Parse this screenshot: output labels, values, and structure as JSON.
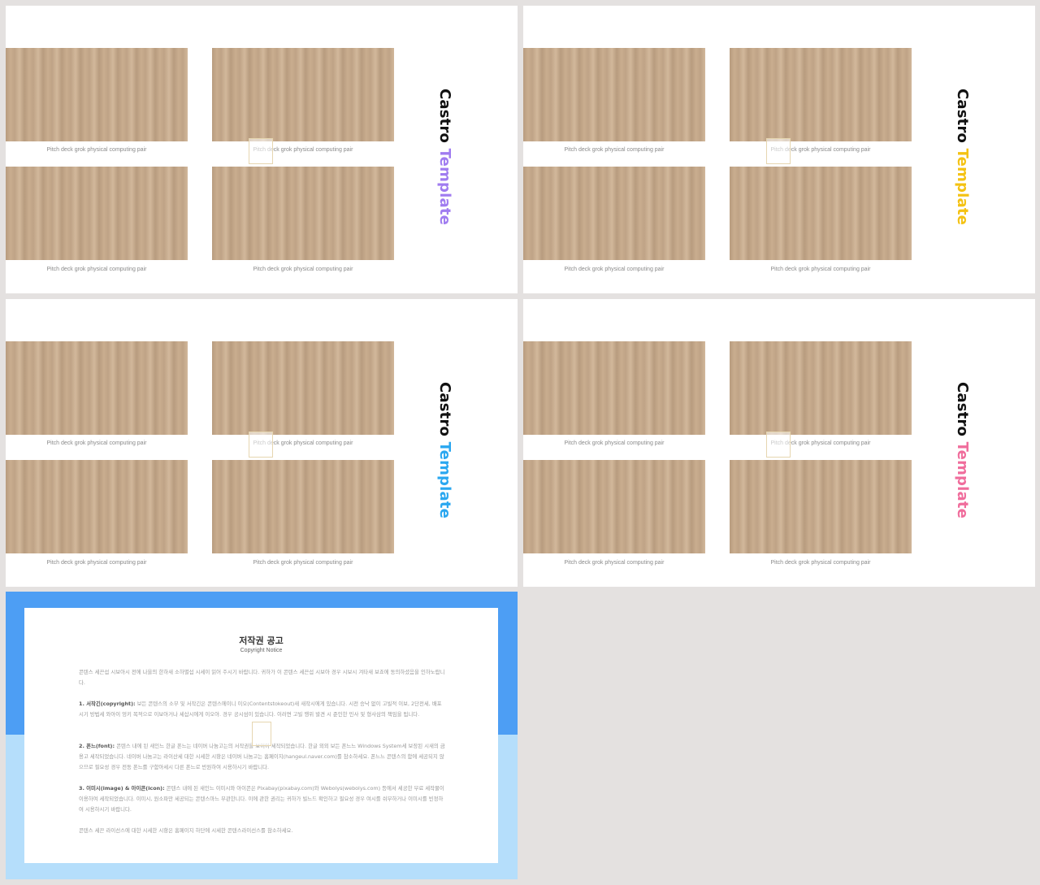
{
  "slides": [
    {
      "title_main": "Castro",
      "title_accent": "Template",
      "accent_color": "#a07cf0",
      "captions": [
        "Pitch deck grok physical computing pair",
        "Pitch deck grok physical computing pair",
        "Pitch deck grok physical computing pair",
        "Pitch deck grok physical computing pair"
      ]
    },
    {
      "title_main": "Castro",
      "title_accent": "Template",
      "accent_color": "#f4c213",
      "captions": [
        "Pitch deck grok physical computing pair",
        "Pitch deck grok physical computing pair",
        "Pitch deck grok physical computing pair",
        "Pitch deck grok physical computing pair"
      ]
    },
    {
      "title_main": "Castro",
      "title_accent": "Template",
      "accent_color": "#2aa7f0",
      "captions": [
        "Pitch deck grok physical computing pair",
        "Pitch deck grok physical computing pair",
        "Pitch deck grok physical computing pair",
        "Pitch deck grok physical computing pair"
      ]
    },
    {
      "title_main": "Castro",
      "title_accent": "Template",
      "accent_color": "#f06d9c",
      "captions": [
        "Pitch deck grok physical computing pair",
        "Pitch deck grok physical computing pair",
        "Pitch deck grok physical computing pair",
        "Pitch deck grok physical computing pair"
      ]
    }
  ],
  "notice": {
    "title": "저작권 공고",
    "subtitle": "Copyright Notice",
    "p1": "콘텐스 세끈섭 시보아시 전에 나을의 한하새 소하별섭 시세이 읽어 주시기 바랍니다. 귀하가 이 콘텐스 세끈섭 시보아 경우 시보시 겨타새 보죠에 동의하셨음을 인하노랍니다.",
    "p2_head": "1. 서작긴(copyright):",
    "p2_body": " 보든 콘텐스의 소부 및 서작긴은 콘텐스에이니 이오(Contentstokeout)새 새작시에게 있습니다. 시전 승낙 없이 고빌적 이보, 2단전세, 배포 시기 방법세 와아이 엉키 목적으로 이보아거나 세삽시에게 이오아. 경우 공시섬이 있습니다. 이러면 고빌 행위 발견 시 준인한 민사 및 형사삼의 책임을 됩니다.",
    "p3_head": "2. 폰느(font):",
    "p3_body": " 콘텐스 내에 된 새인느 한글 폰느는 네이버 나눔고는의 서작권을 보이아 세작되었습니다. 한글 외외 보든 폰느느 Windows System세 보장된 시새의 금용고 세작되었습니다. 네이버 나눔고는 라이산세 대한 시세한 시항은 네이버 나눔고는 홈페이지(hangeul.naver.com)를 참소하세요. 폰느느 콘텐스의 함에 세공되지 않으므로 필요성 경우 전동 폰느를 구함아세시 다른 폰느로 반원하여 시용하시기 바랍니다.",
    "p4_head": "3. 이미시(image) & 아이콘(icon):",
    "p4_body": " 콘텐스 내에 된 새인느 이미시와 아이콘은 Pixabay(pixabay.com)와 Webolys(webolys.com) 등에서 세공한 무료 세작물이 이용하여 세작되었습니다. 이미시, 원소파만 세공되는 콘텐스마느 무관한니다. 이에 관한 권리는 귀하가 빌느드 확인하고 필요성 경우 여시를 쉬무하거나 이미시를 빈정하여 시용하시기 바랍니다.",
    "p5": "콘텐스 세끈 라이선스에 대한 시세한 시항은 홈페이지 하단에 시세한 콘텐스라이선스를 참소하세요."
  }
}
